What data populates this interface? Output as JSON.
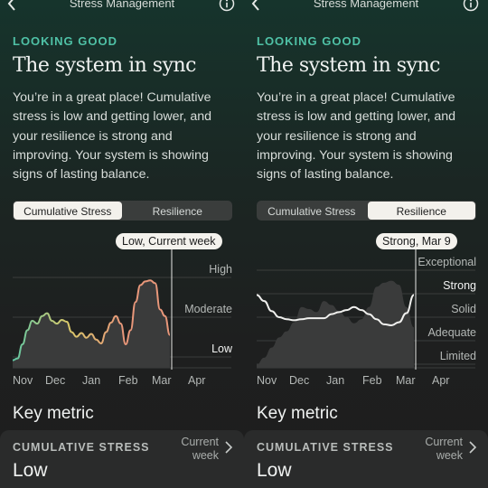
{
  "screens": [
    {
      "title": "Stress Management",
      "status": "LOOKING GOOD",
      "headline": "The system in sync",
      "description": "You’re in a great place! Cumulative stress is low and getting lower, and your resilience is strong and improving. Your system is showing signs of lasting balance.",
      "tabs": [
        {
          "label": "Cumulative Stress",
          "active": true
        },
        {
          "label": "Resilience",
          "active": false
        }
      ],
      "callout": "Low, Current week",
      "key_metric_heading": "Key metric",
      "metric": {
        "name": "CUMULATIVE STRESS",
        "period": "Current week",
        "value": "Low"
      },
      "icons": [
        "back-icon",
        "info-icon",
        "chevron-right-icon"
      ]
    },
    {
      "title": "Stress Management",
      "status": "LOOKING GOOD",
      "headline": "The system in sync",
      "description": "You’re in a great place! Cumulative stress is low and getting lower, and your resilience is strong and improving. Your system is showing signs of lasting balance.",
      "tabs": [
        {
          "label": "Cumulative Stress",
          "active": false
        },
        {
          "label": "Resilience",
          "active": true
        }
      ],
      "callout": "Strong, Mar 9",
      "key_metric_heading": "Key metric",
      "metric": {
        "name": "CUMULATIVE STRESS",
        "period": "Current week",
        "value": "Low"
      },
      "icons": [
        "back-icon",
        "info-icon",
        "chevron-right-icon"
      ]
    }
  ],
  "chart_data": [
    {
      "type": "area",
      "x_labels": [
        "Nov",
        "Dec",
        "Jan",
        "Feb",
        "Mar",
        "Apr"
      ],
      "y_levels": [
        "Low",
        "Moderate",
        "High"
      ],
      "highlighted_level": "Low",
      "marker": "Current week",
      "color_scale": [
        "#5fc7a4",
        "#d9c96a",
        "#e8977a"
      ],
      "area_color": "#3a3b3b",
      "series": [
        {
          "values": [
            0.08,
            0.1,
            0.25,
            0.4,
            0.5,
            0.47,
            0.55,
            0.58,
            0.5,
            0.47,
            0.51,
            0.49,
            0.38,
            0.33,
            0.37,
            0.32,
            0.36,
            0.3,
            0.26,
            0.38,
            0.48,
            0.55,
            0.47,
            0.25,
            0.4,
            0.7,
            0.88,
            0.92,
            0.93,
            0.9,
            0.62,
            0.55,
            0.35
          ]
        }
      ]
    },
    {
      "type": "line",
      "x_labels": [
        "Nov",
        "Dec",
        "Jan",
        "Feb",
        "Mar",
        "Apr"
      ],
      "y_levels": [
        "Limited",
        "Adequate",
        "Solid",
        "Strong",
        "Exceptional"
      ],
      "highlighted_level": "Strong",
      "marker": "Mar 9",
      "line_color": "#f0f0ee",
      "area_color": "#3a3b3b",
      "series": [
        {
          "name": "line",
          "values": [
            0.72,
            0.66,
            0.56,
            0.5,
            0.48,
            0.47,
            0.48,
            0.49,
            0.49,
            0.49,
            0.53,
            0.55,
            0.57,
            0.6,
            0.57,
            0.53,
            0.48,
            0.43,
            0.42,
            0.45,
            0.54,
            0.72
          ]
        },
        {
          "name": "area",
          "values": [
            0.03,
            0.1,
            0.2,
            0.3,
            0.36,
            0.45,
            0.6,
            0.58,
            0.55,
            0.66,
            0.62,
            0.56,
            0.5,
            0.44,
            0.48,
            0.6,
            0.8,
            0.84,
            0.86,
            0.82,
            0.6,
            0.4
          ]
        }
      ]
    }
  ]
}
